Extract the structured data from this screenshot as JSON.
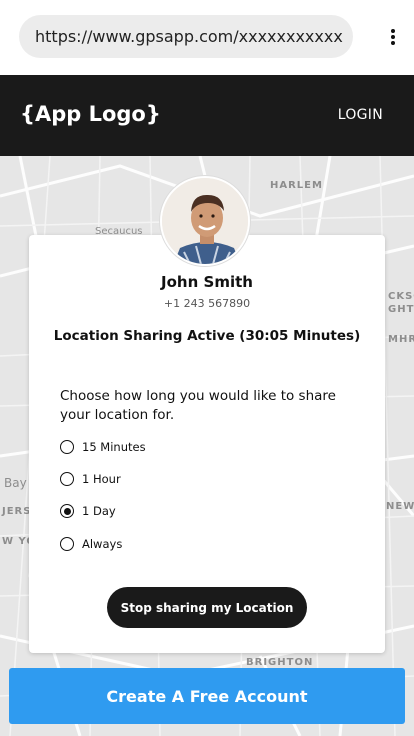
{
  "browser": {
    "url": "https://www.gpsapp.com/xxxxxxxxxxx",
    "menu_icon": "kebab-menu-icon"
  },
  "header": {
    "logo": "{App Logo}",
    "login_label": "LOGIN",
    "background": "#1a1a1a"
  },
  "map": {
    "labels": [
      "HARLEM",
      "Secaucus",
      "Bay",
      "JERS",
      "W YOR",
      "NEW YOR",
      "BRIGHTON",
      "CKSO",
      "GHTS",
      "MHR"
    ]
  },
  "profile": {
    "avatar_icon": "user-avatar-photo",
    "name": "John Smith",
    "phone": "+1 243 567890"
  },
  "status": "Location Sharing Active (30:05 Minutes)",
  "duration": {
    "prompt": "Choose how long you would like to share your location for.",
    "options": [
      {
        "label": "15 Minutes",
        "selected": false
      },
      {
        "label": "1 Hour",
        "selected": false
      },
      {
        "label": "1 Day",
        "selected": true
      },
      {
        "label": "Always",
        "selected": false
      }
    ]
  },
  "actions": {
    "stop_label": "Stop sharing my Location",
    "cta_label": "Create A Free Account"
  },
  "colors": {
    "accent": "#2f9bf0",
    "dark": "#1a1a1a",
    "map": "#e6e6e6"
  }
}
